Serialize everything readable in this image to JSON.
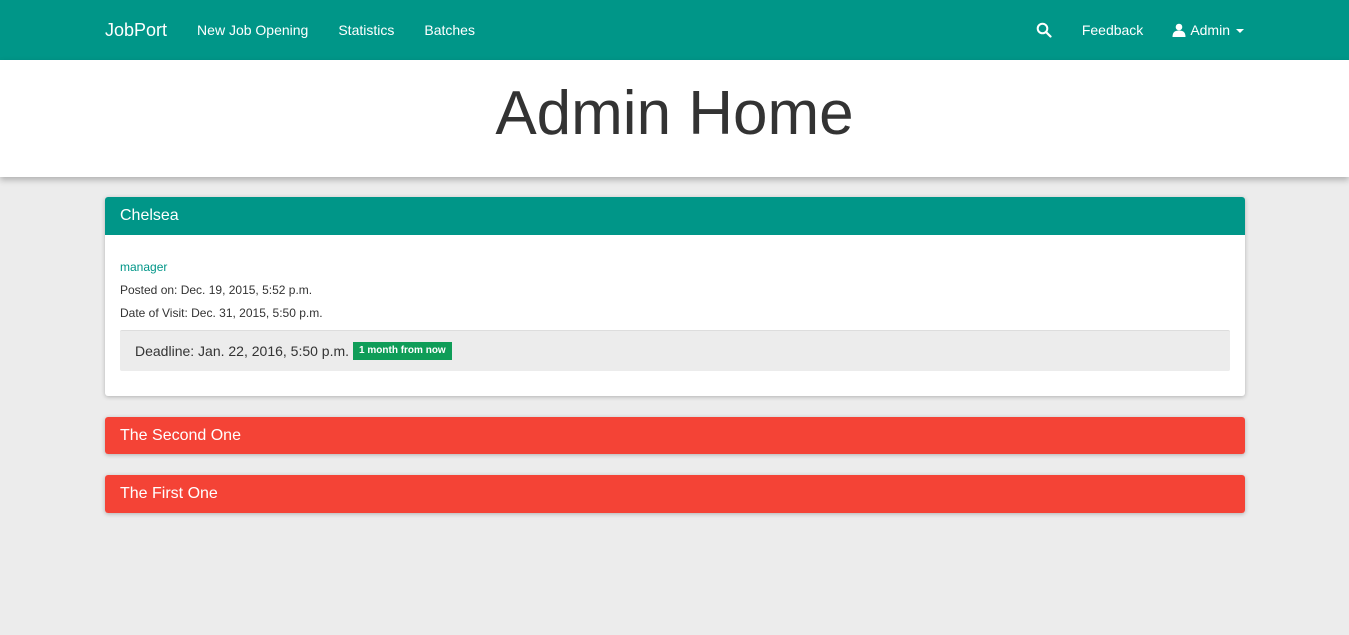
{
  "colors": {
    "primary": "#009688",
    "danger": "#f44336",
    "success": "#0f9d58",
    "background": "#ececec"
  },
  "navbar": {
    "brand": "JobPort",
    "links": [
      "New Job Opening",
      "Statistics",
      "Batches"
    ],
    "search_icon": "search-icon",
    "feedback": "Feedback",
    "user_icon": "user-icon",
    "user_label": "Admin"
  },
  "hero": {
    "title": "Admin Home"
  },
  "jobs": [
    {
      "company": "Chelsea",
      "status_color": "#009688",
      "expanded": true,
      "title": "manager",
      "posted": "Posted on: Dec. 19, 2015, 5:52 p.m.",
      "visit": "Date of Visit: Dec. 31, 2015, 5:50 p.m.",
      "deadline": "Deadline: Jan. 22, 2016, 5:50 p.m.",
      "badge": "1 month from now"
    },
    {
      "company": "The Second One",
      "status_color": "#f44336",
      "expanded": false
    },
    {
      "company": "The First One",
      "status_color": "#f44336",
      "expanded": false
    }
  ]
}
